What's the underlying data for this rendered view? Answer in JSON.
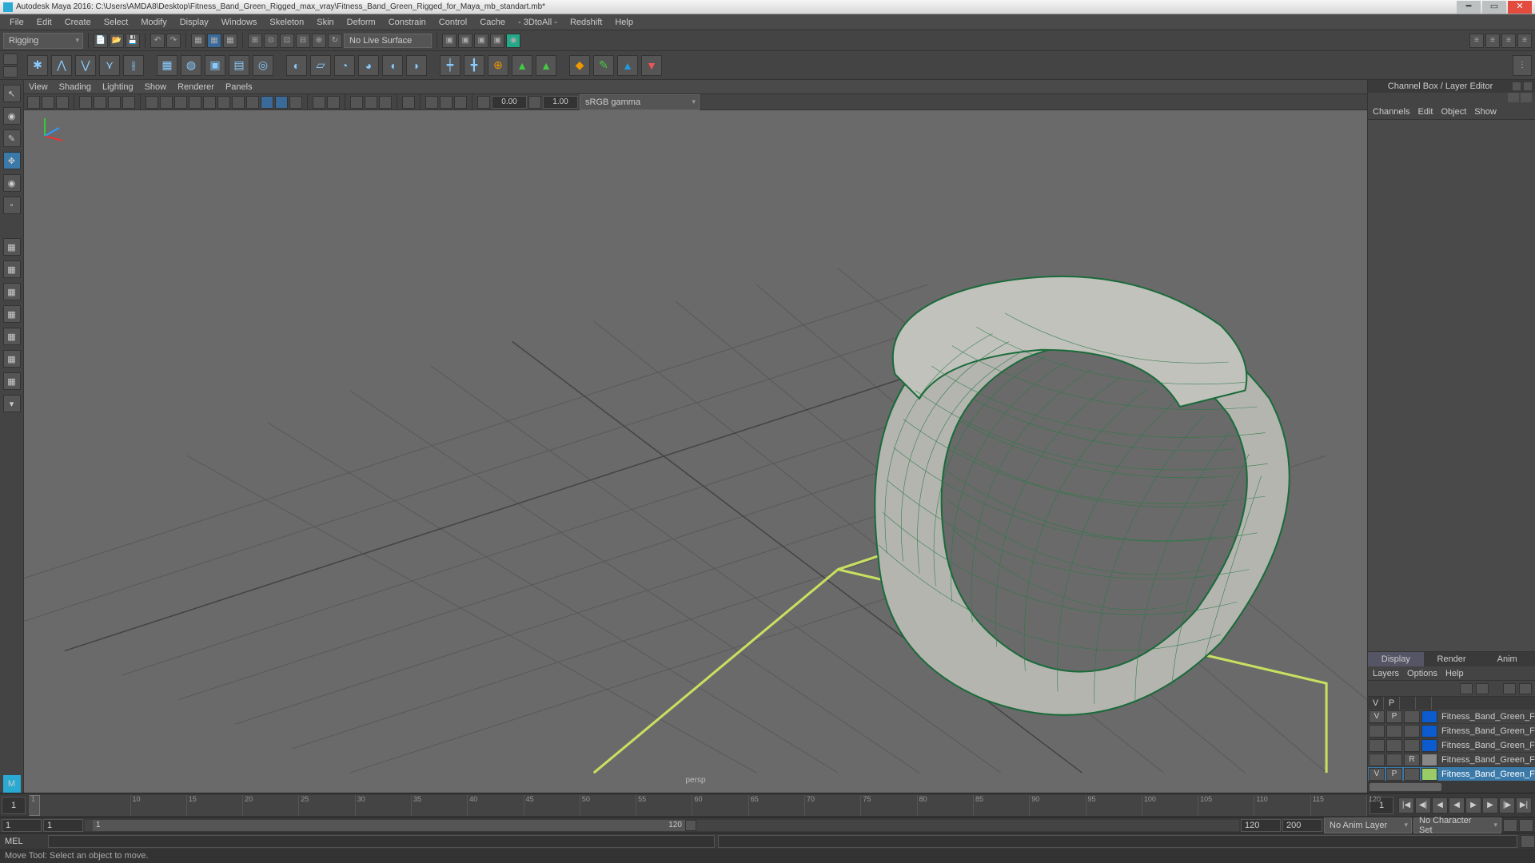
{
  "title": "Autodesk Maya 2016: C:\\Users\\AMDA8\\Desktop\\Fitness_Band_Green_Rigged_max_vray\\Fitness_Band_Green_Rigged_for_Maya_mb_standart.mb*",
  "menu": [
    "File",
    "Edit",
    "Create",
    "Select",
    "Modify",
    "Display",
    "Windows",
    "Skeleton",
    "Skin",
    "Deform",
    "Constrain",
    "Control",
    "Cache",
    "- 3DtoAll -",
    "Redshift",
    "Help"
  ],
  "moduleDropdown": "Rigging",
  "noLiveSurface": "No Live Surface",
  "viewportMenus": [
    "View",
    "Shading",
    "Lighting",
    "Show",
    "Renderer",
    "Panels"
  ],
  "exposure": "0.00",
  "gamma": "1.00",
  "colorspace": "sRGB gamma",
  "camera": "persp",
  "rightPanel": {
    "title": "Channel Box / Layer Editor",
    "tabs": [
      "Channels",
      "Edit",
      "Object",
      "Show"
    ],
    "bottomTabs": [
      "Display",
      "Render",
      "Anim"
    ],
    "bottomMenu": [
      "Layers",
      "Options",
      "Help"
    ],
    "layerHeader": [
      "V",
      "P"
    ],
    "layers": [
      {
        "v": "V",
        "p": "P",
        "r": "",
        "color": "#0c5ccf",
        "name": "Fitness_Band_Green_F"
      },
      {
        "v": "",
        "p": "",
        "r": "",
        "color": "#0c5ccf",
        "name": "Fitness_Band_Green_F"
      },
      {
        "v": "",
        "p": "",
        "r": "",
        "color": "#0c5ccf",
        "name": "Fitness_Band_Green_F"
      },
      {
        "v": "",
        "p": "",
        "r": "R",
        "color": "#888",
        "name": "Fitness_Band_Green_F"
      },
      {
        "v": "V",
        "p": "P",
        "r": "",
        "color": "#9c6",
        "name": "Fitness_Band_Green_F",
        "selected": true
      }
    ]
  },
  "timeline": {
    "start": "1",
    "end": "1",
    "ticks": [
      1,
      10,
      15,
      20,
      25,
      30,
      35,
      40,
      45,
      50,
      55,
      60,
      65,
      70,
      75,
      80,
      85,
      90,
      95,
      100,
      105,
      110,
      115,
      120
    ],
    "rangeCur": "1",
    "rangeEnd": "120",
    "rangeMin": "1",
    "rangeMax": "1",
    "playStart": "120",
    "playEnd": "200",
    "animLayer": "No Anim Layer",
    "charSet": "No Character Set"
  },
  "cmdLabel": "MEL",
  "status": "Move Tool: Select an object to move."
}
